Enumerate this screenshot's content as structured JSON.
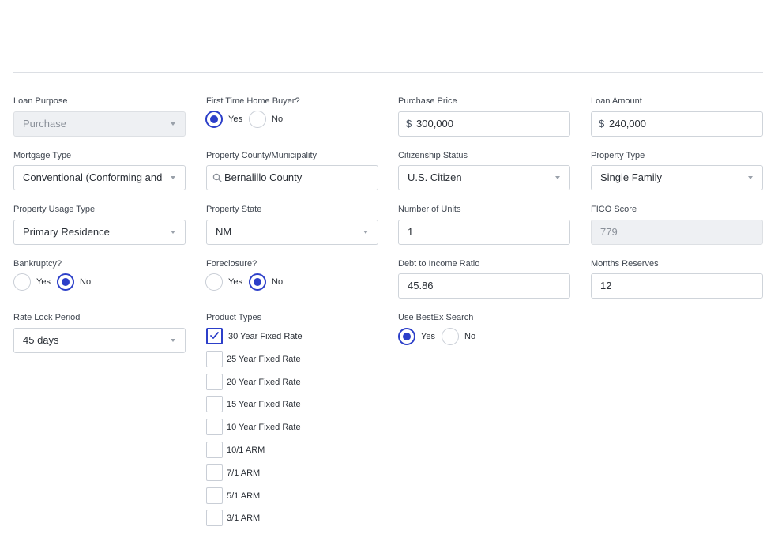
{
  "form": {
    "loan_purpose": {
      "label": "Loan Purpose",
      "value": "Purchase"
    },
    "first_time_buyer": {
      "label": "First Time Home Buyer?",
      "yes": "Yes",
      "no": "No",
      "selected": "Yes"
    },
    "purchase_price": {
      "label": "Purchase Price",
      "prefix": "$",
      "value": "300,000"
    },
    "loan_amount": {
      "label": "Loan Amount",
      "prefix": "$",
      "value": "240,000"
    },
    "mortgage_type": {
      "label": "Mortgage Type",
      "value": "Conventional (Conforming and Non-Conforming)"
    },
    "property_county": {
      "label": "Property County/Municipality",
      "value": "Bernalillo County"
    },
    "citizenship": {
      "label": "Citizenship Status",
      "value": "U.S. Citizen"
    },
    "property_type": {
      "label": "Property Type",
      "value": "Single Family"
    },
    "property_usage": {
      "label": "Property Usage Type",
      "value": "Primary Residence"
    },
    "property_state": {
      "label": "Property State",
      "value": "NM"
    },
    "number_of_units": {
      "label": "Number of Units",
      "value": "1"
    },
    "fico": {
      "label": "FICO Score",
      "value": "779"
    },
    "bankruptcy": {
      "label": "Bankruptcy?",
      "yes": "Yes",
      "no": "No",
      "selected": "No"
    },
    "foreclosure": {
      "label": "Foreclosure?",
      "yes": "Yes",
      "no": "No",
      "selected": "No"
    },
    "dti": {
      "label": "Debt to Income Ratio",
      "value": "45.86"
    },
    "months_reserves": {
      "label": "Months Reserves",
      "value": "12"
    },
    "rate_lock": {
      "label": "Rate Lock Period",
      "value": "45 days"
    },
    "product_types": {
      "label": "Product Types",
      "items": [
        {
          "label": "30 Year Fixed Rate",
          "checked": true
        },
        {
          "label": "25 Year Fixed Rate",
          "checked": false
        },
        {
          "label": "20 Year Fixed Rate",
          "checked": false
        },
        {
          "label": "15 Year Fixed Rate",
          "checked": false
        },
        {
          "label": "10 Year Fixed Rate",
          "checked": false
        },
        {
          "label": "10/1 ARM",
          "checked": false
        },
        {
          "label": "7/1 ARM",
          "checked": false
        },
        {
          "label": "5/1 ARM",
          "checked": false
        },
        {
          "label": "3/1 ARM",
          "checked": false
        }
      ]
    },
    "bestex": {
      "label": "Use BestEx Search",
      "yes": "Yes",
      "no": "No",
      "selected": "Yes"
    }
  },
  "colors": {
    "accent": "#2c3fc9",
    "border": "#cfd4da",
    "disabled_bg": "#eef0f3"
  },
  "icons": {
    "select": "chevron-down-icon",
    "search": "search-icon",
    "check": "checkmark-icon"
  }
}
